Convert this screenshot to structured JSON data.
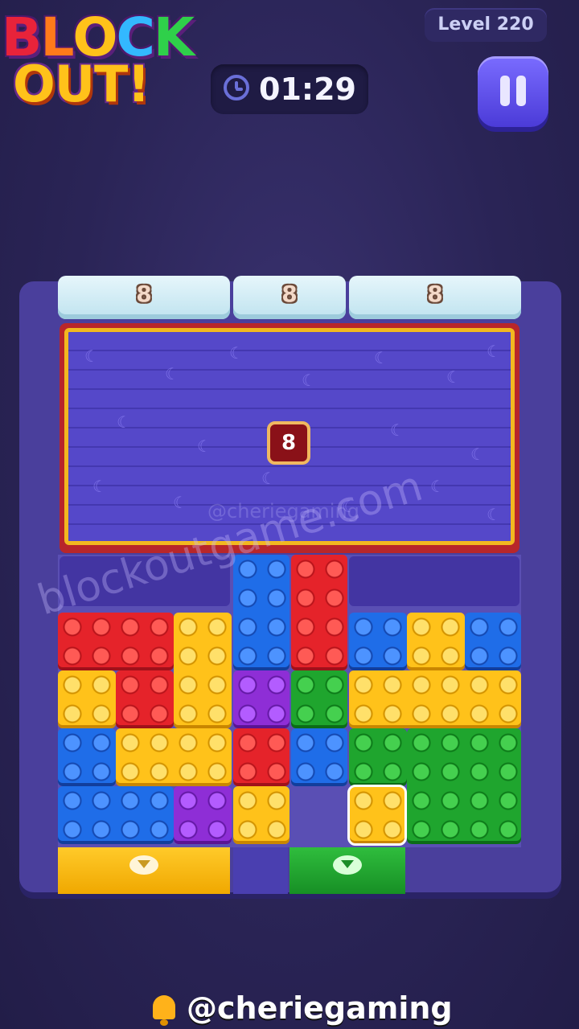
{
  "logo": {
    "line1": "BLOCK",
    "line2": "OUT!"
  },
  "header": {
    "level_label": "Level 220",
    "timer": "01:29"
  },
  "top_targets": [
    {
      "count": "8"
    },
    {
      "count": "8"
    },
    {
      "count": "8"
    }
  ],
  "curtain_lock": "8",
  "watermarks": {
    "main": "blockoutgame.com",
    "faint": "@cheriegaming"
  },
  "footer": {
    "handle": "@cheriegaming"
  },
  "colors": {
    "red": "#e5232a",
    "yellow": "#ffc21a",
    "blue": "#1f6de8",
    "green": "#1fa52e",
    "purple": "#8e2ed6"
  },
  "icons": {
    "timer": "clock-icon",
    "pause": "pause-icon",
    "exit": "down-arrow-icon",
    "footer": "bell-icon"
  }
}
